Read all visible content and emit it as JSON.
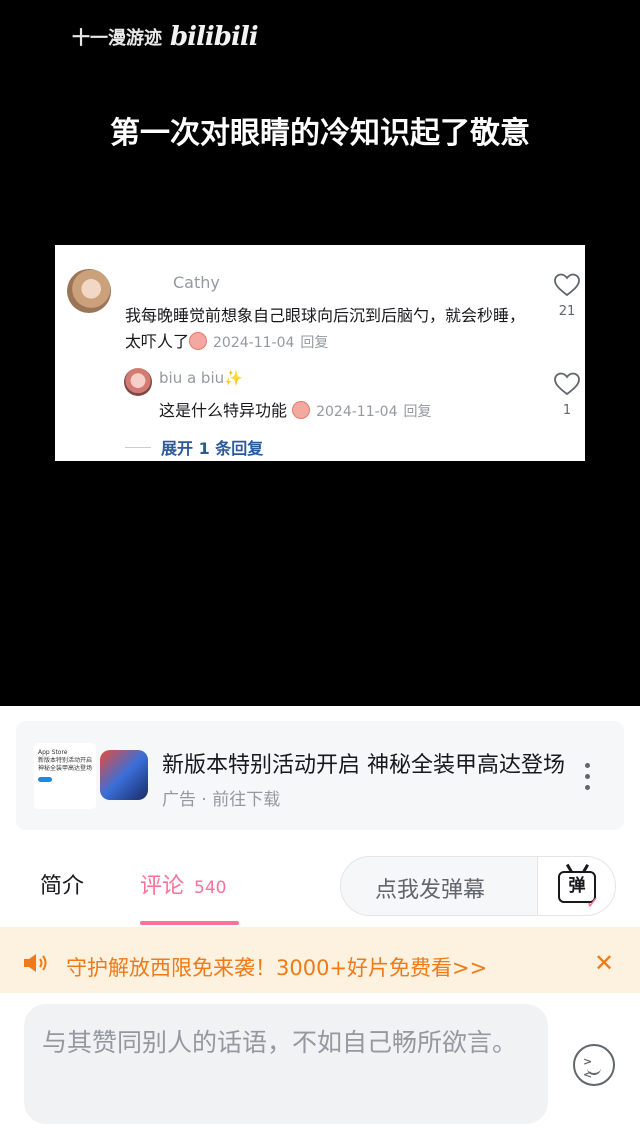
{
  "video": {
    "watermark_channel": "十一漫游迹",
    "watermark_brand": "bilibili",
    "title": "第一次对眼睛的冷知识起了敬意",
    "comment": {
      "username": "Cathy",
      "text": "我每晚睡觉前想象自己眼球向后沉到后脑勺，就会秒睡，太吓人了",
      "date": "2024-11-04",
      "reply_label": "回复",
      "likes": "21"
    },
    "reply": {
      "username": "biu a biu✨",
      "text": "这是什么特异功能",
      "date": "2024-11-04",
      "reply_label": "回复",
      "likes": "1"
    },
    "expand_label": "展开 1 条回复"
  },
  "ad": {
    "thumb_line1": "App Store",
    "thumb_line2": "新版本特别活动开启",
    "thumb_line3": "神秘全装甲高达登场",
    "title": "新版本特别活动开启 神秘全装甲高达登场",
    "subtitle": "广告 · 前往下载",
    "more_icon": "more-vertical-icon"
  },
  "tabs": {
    "intro": "简介",
    "comment": "评论",
    "comment_count": "540",
    "active_color": "#fb7299"
  },
  "danmaku": {
    "placeholder": "点我发弹幕",
    "icon_char": "弹",
    "check_char": "✓"
  },
  "banner": {
    "text": "守护解放西限免来袭！3000+好片免费看>>",
    "close": "✕",
    "color": "#f07a17"
  },
  "input": {
    "placeholder": "与其赞同别人的话语，不如自己畅所欲言。"
  }
}
